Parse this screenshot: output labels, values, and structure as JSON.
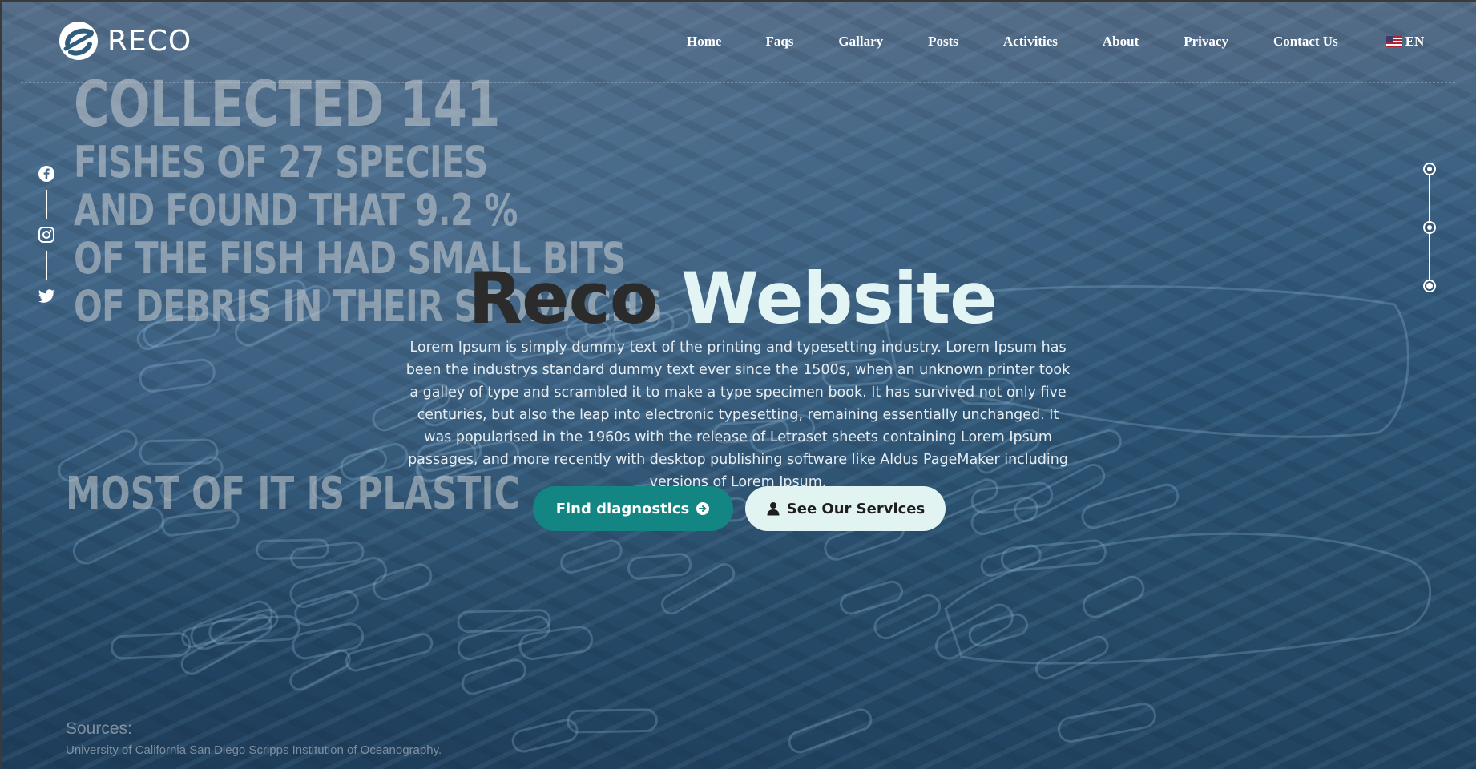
{
  "colors": {
    "accent": "#138683",
    "secondary_button_bg": "#e2f4f2",
    "title_dark": "#2b2b2b",
    "title_light": "#e2f4f4"
  },
  "header": {
    "logo_text": "RECO",
    "nav": {
      "home": "Home",
      "faqs": "Faqs",
      "gallary": "Gallary",
      "posts": "Posts",
      "activities": "Activities",
      "about": "About",
      "privacy": "Privacy",
      "contact": "Contact Us"
    },
    "language": {
      "flag_icon": "us-flag-icon",
      "label": "EN"
    }
  },
  "social": {
    "icons": [
      "facebook-icon",
      "instagram-icon",
      "twitter-icon"
    ]
  },
  "slider": {
    "dot_count": 3,
    "active_index": 2
  },
  "background_poster": {
    "line1": "COLLECTED 141",
    "line2": "FISHES OF 27 SPECIES",
    "line3": "AND FOUND THAT 9.2 %",
    "line4": "OF THE FISH HAD SMALL BITS",
    "line5": "OF DEBRIS IN THEIR STOMACHS",
    "plastic": "MOST OF IT IS PLASTIC",
    "sources_label": "Sources:",
    "sources_text": "University of California San Diego Scripps Institution of Oceanography."
  },
  "hero": {
    "title_part1": "Reco",
    "title_part2": "Website",
    "description": "Lorem Ipsum is simply dummy text of the printing and typesetting industry. Lorem Ipsum has been the industrys standard dummy text ever since the 1500s, when an unknown printer took a galley of type and scrambled it to make a type specimen book. It has survived not only five centuries, but also the leap into electronic typesetting, remaining essentially unchanged. It was popularised in the 1960s with the release of Letraset sheets containing Lorem Ipsum passages, and more recently with desktop publishing software like Aldus PageMaker including versions of Lorem Ipsum.",
    "primary_button": {
      "label": "Find diagnostics",
      "icon": "arrow-right-circle-icon"
    },
    "secondary_button": {
      "label": "See Our Services",
      "icon": "user-icon"
    }
  }
}
